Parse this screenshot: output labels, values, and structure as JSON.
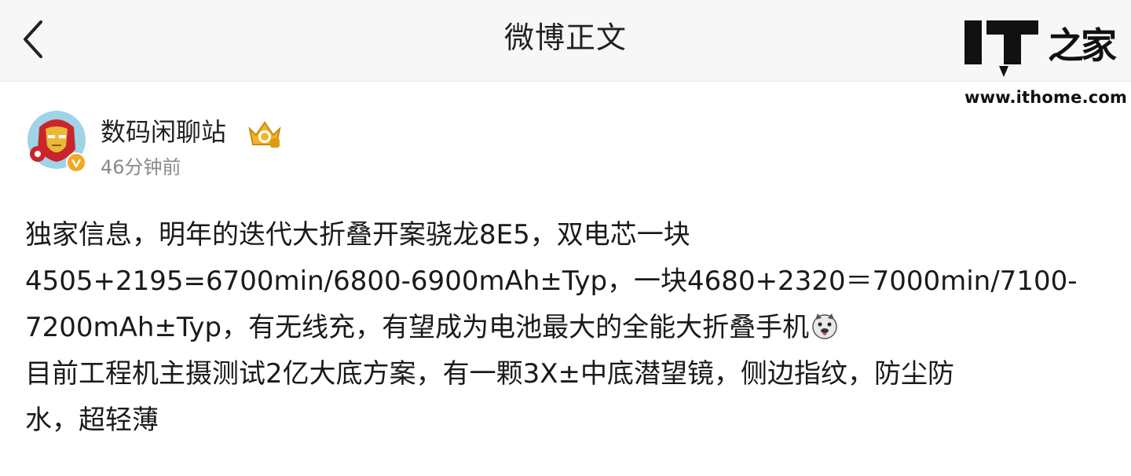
{
  "header": {
    "title": "微博正文",
    "back_icon": "chevron-left-icon"
  },
  "watermark": {
    "logo_text": "IT之家",
    "url": "www.ithome.com"
  },
  "author": {
    "name": "数码闲聊站",
    "time": "46分钟前",
    "avatar_icon": "iron-man-avatar",
    "verified_icon": "verified-v-icon",
    "level_icon": "crown-level-badge-icon"
  },
  "post": {
    "lines": [
      "独家信息，明年的迭代大折叠开案骁龙8E5，双电芯一块",
      "4505+2195=6700min/6800-6900mAh±Typ，一块4680+2320＝7000min/7100-",
      "7200mAh±Typ，有无线充，有望成为电池最大的全能大折叠手机",
      "目前工程机主摄测试2亿大底方案，有一颗3X±中底潜望镜，侧边指纹，防尘防",
      "水，超轻薄"
    ],
    "emoji_icon": "doge-emoji-icon"
  },
  "colors": {
    "header_bg": "#f7f7f7",
    "verified": "#f5a623",
    "time": "#8a8a8a"
  }
}
